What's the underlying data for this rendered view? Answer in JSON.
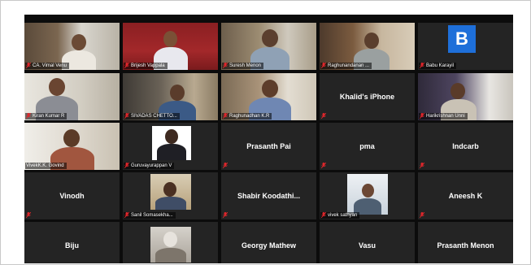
{
  "participants": [
    {
      "name": "CA. Vimal Venu"
    },
    {
      "name": "Brijesh Vappala"
    },
    {
      "name": "Suresh Menon"
    },
    {
      "name": "Raghunandanan ..."
    },
    {
      "name": "Babu Karayil",
      "avatar_letter": "B",
      "avatar_color": "#1e6fd9"
    },
    {
      "name": "Kiran Kumar R"
    },
    {
      "name": "SIVADAS CHETTO..."
    },
    {
      "name": "Raghunadhan K.R"
    },
    {
      "name": "Khalid's iPhone"
    },
    {
      "name": "Harikrishnan Unni"
    },
    {
      "name": "VivekK.K. Govind",
      "active": true
    },
    {
      "name": "Guruvayurappan V"
    },
    {
      "name": "Prasanth Pai"
    },
    {
      "name": "pma"
    },
    {
      "name": "Indcarb"
    },
    {
      "name": "Vinodh"
    },
    {
      "name": "Sanil Somasekha..."
    },
    {
      "name": "Shabir  Koodathi..."
    },
    {
      "name": "vivek sathyan"
    },
    {
      "name": "Aneesh K"
    },
    {
      "name": "Biju"
    },
    {
      "name": ""
    },
    {
      "name": "Georgy Mathew"
    },
    {
      "name": "Vasu"
    },
    {
      "name": "Prasanth Menon"
    }
  ],
  "colors": {
    "active_speaker_border": "#b7d33a",
    "muted_icon": "#e0262b",
    "tile_background": "#242424"
  }
}
